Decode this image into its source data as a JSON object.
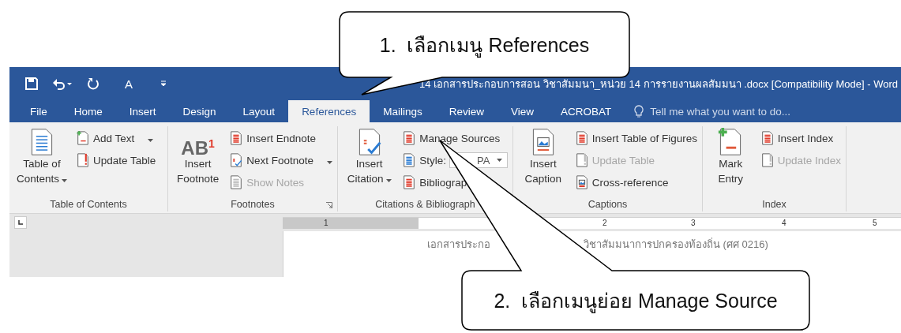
{
  "callouts": [
    {
      "text": "1.  เลือกเมนู References"
    },
    {
      "text": "2.  เลือกเมนูย่อย Manage Source"
    }
  ],
  "window": {
    "title": "14 เอกสารประกอบการสอน วิชาสัมมนา_หน่วย 14  การรายงานผลสัมมนา .docx [Compatibility Mode] - Word",
    "qat_text": "A"
  },
  "tabs": [
    {
      "label": "File",
      "selected": false
    },
    {
      "label": "Home",
      "selected": false
    },
    {
      "label": "Insert",
      "selected": false
    },
    {
      "label": "Design",
      "selected": false
    },
    {
      "label": "Layout",
      "selected": false
    },
    {
      "label": "References",
      "selected": true
    },
    {
      "label": "Mailings",
      "selected": false
    },
    {
      "label": "Review",
      "selected": false
    },
    {
      "label": "View",
      "selected": false
    },
    {
      "label": "ACROBAT",
      "selected": false
    }
  ],
  "tell_me": {
    "placeholder": "Tell me what you want to do..."
  },
  "ribbon_groups": [
    {
      "label": "Table of Contents",
      "launcher": false,
      "large": {
        "label": "Table of Contents",
        "dropdown": true
      },
      "items": [
        {
          "kind": "button",
          "label": "Add Text",
          "dropdown": true,
          "disabled": false
        },
        {
          "kind": "button",
          "label": "Update Table",
          "dropdown": false,
          "disabled": false
        }
      ]
    },
    {
      "label": "Footnotes",
      "launcher": true,
      "large": {
        "label": "Insert Footnote",
        "glyph": "AB$^{1}$",
        "dropdown": false
      },
      "items": [
        {
          "kind": "button",
          "label": "Insert Endnote",
          "dropdown": false,
          "disabled": false
        },
        {
          "kind": "button",
          "label": "Next Footnote",
          "dropdown": true,
          "disabled": false
        },
        {
          "kind": "button",
          "label": "Show Notes",
          "dropdown": false,
          "disabled": true
        }
      ]
    },
    {
      "label": "Citations & Bibliograph",
      "launcher": false,
      "large": {
        "label": "Insert Citation",
        "dropdown": true
      },
      "items": [
        {
          "kind": "button",
          "label": "Manage Sources",
          "dropdown": false,
          "disabled": false
        },
        {
          "kind": "field",
          "label": "Style:",
          "value": "PA"
        },
        {
          "kind": "button",
          "label": "Bibliograp",
          "dropdown": false,
          "disabled": false
        }
      ]
    },
    {
      "label": "Captions",
      "launcher": false,
      "large": {
        "label": "Insert Caption",
        "dropdown": false
      },
      "items": [
        {
          "kind": "button",
          "label": "Insert Table of Figures",
          "dropdown": false,
          "disabled": false
        },
        {
          "kind": "button",
          "label": "Update Table",
          "dropdown": false,
          "disabled": true
        },
        {
          "kind": "button",
          "label": "Cross-reference",
          "dropdown": false,
          "disabled": false
        }
      ]
    },
    {
      "label": "Index",
      "launcher": false,
      "large": {
        "label": "Mark Entry",
        "dropdown": false
      },
      "items": [
        {
          "kind": "button",
          "label": "Insert Index",
          "dropdown": false,
          "disabled": false
        },
        {
          "kind": "button",
          "label": "Update Index",
          "dropdown": false,
          "disabled": true
        }
      ]
    }
  ],
  "ruler": {
    "numbers": [
      "1",
      "2",
      "3",
      "4",
      "5"
    ]
  },
  "document": {
    "header_parts": [
      "เอกสารประกอ",
      "วิชาสัมมนาการปกครองท้องถิ่น (ศศ 0216)"
    ]
  }
}
